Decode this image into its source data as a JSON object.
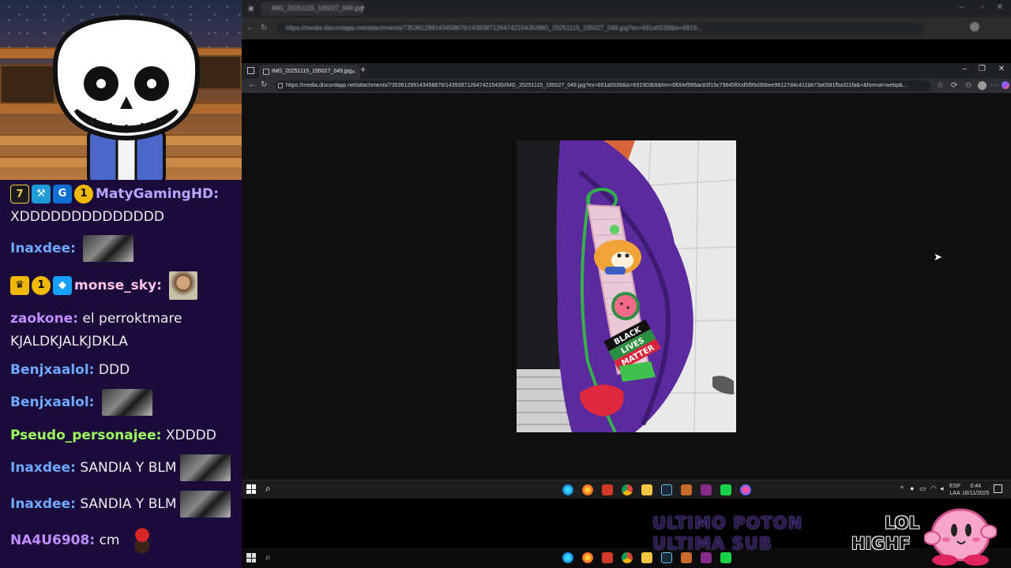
{
  "chat": {
    "messages": [
      {
        "user": "MatyGamingHD",
        "user_color": "#b7a6ff",
        "text": "XDDDDDDDDDDDDDD",
        "badges": [
          "7tv",
          "hammer",
          "gg",
          "1"
        ]
      },
      {
        "user": "Inaxdee",
        "user_color": "#6fa8ff",
        "text": "",
        "emote": "blurred-emote"
      },
      {
        "user": "monse_sky",
        "user_color": "#ffc3e8",
        "text": "",
        "badges": [
          "crown",
          "1",
          "cube"
        ],
        "emote": "face-emote"
      },
      {
        "user": "zaokone",
        "user_color": "#c18cff",
        "text": "el perroktmare KJALDKJALKJDKLA"
      },
      {
        "user": "Benjxaalol",
        "user_color": "#6fa8ff",
        "text": "DDD"
      },
      {
        "user": "Benjxaalol",
        "user_color": "#6fa8ff",
        "text": "",
        "emote": "blurred-emote"
      },
      {
        "user": "Pseudo_personajee",
        "user_color": "#9dff5e",
        "text": "XDDDD"
      },
      {
        "user": "Inaxdee",
        "user_color": "#6fa8ff",
        "text": "SANDIA Y BLM",
        "emote": "blurred-emote"
      },
      {
        "user": "Inaxdee",
        "user_color": "#6fa8ff",
        "text": "SANDIA Y BLM",
        "emote": "blurred-emote"
      },
      {
        "user": "NA4U6908",
        "user_color": "#c18cff",
        "text": "cm",
        "emote": "cap-emote"
      }
    ]
  },
  "outer_browser": {
    "tab_title": "IMG_20251115_195027_049.jpg",
    "url": "https://media.discordapp.net/attachments/735361299143458876/1439387126474215435/IMG_20251115_195027_049.jpg?ex=691a5539&is=6919..."
  },
  "browser": {
    "tab_title": "IMG_20251115_195027_049.jpg",
    "url": "https://media.discordapp.net/attachments/735361299143458876/1439387126474215435/IMG_20251115_195027_049.jpg?ex=691a5539&is=691903b9&hm=6f00ef966ac83f15c79645f0cd5f95d35bee96127d4c411bb73a0581f5a311fa&=&format=webp&...",
    "new_tab": "+",
    "close_tab": "×"
  },
  "photo": {
    "strap_text_1": "BLACK",
    "strap_text_2": "LIVES",
    "strap_text_3": "MATTER",
    "colors": {
      "bag": "#5b2a9e",
      "strap": "#e9c9d6",
      "floor": "#ececec"
    }
  },
  "taskbar": {
    "lang_top": "ESP",
    "lang_bottom": "LAA",
    "time": "0:44",
    "date": "16/11/2025"
  },
  "overlay": {
    "line1": "ULTIMO POTON",
    "line2": "ULTIMA SUB",
    "lol_line1": "LOL",
    "lol_line2": "HIGHF"
  },
  "icons": [
    "windows-icon",
    "search-icon",
    "edge-icon",
    "firefox-icon",
    "chrome-icon",
    "folder-icon",
    "steam-icon",
    "back-icon",
    "refresh-icon",
    "star-icon",
    "mouse-cursor-icon"
  ]
}
